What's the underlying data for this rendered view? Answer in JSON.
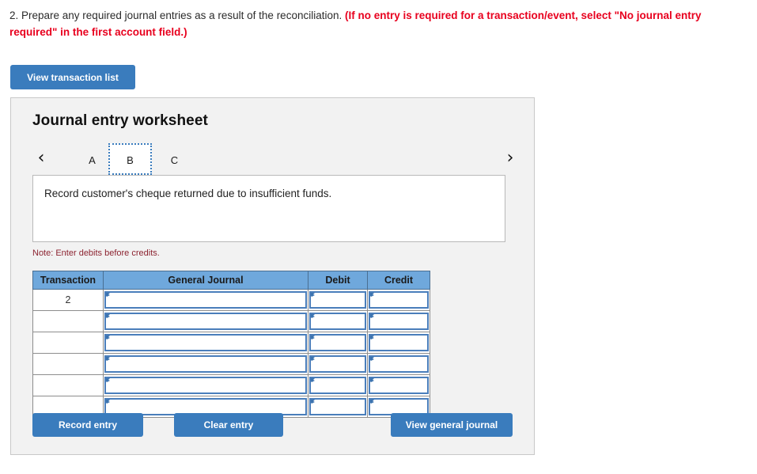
{
  "instruction": {
    "plain": "2. Prepare any required journal entries as a result of the reconciliation. ",
    "emphasis": "(If no entry is required for a transaction/event, select \"No journal entry required\" in the first account field.)"
  },
  "toolbar": {
    "view_transaction_list_label": "View transaction list"
  },
  "worksheet": {
    "title": "Journal entry worksheet",
    "tabs": [
      {
        "label": "A",
        "active": false
      },
      {
        "label": "B",
        "active": true
      },
      {
        "label": "C",
        "active": false
      }
    ],
    "nav": {
      "prev_icon": "chevron-left-icon",
      "next_icon": "chevron-right-icon",
      "prev_glyph": "‹",
      "next_glyph": "›"
    },
    "description": "Record customer's cheque returned due to insufficient funds.",
    "note": "Note: Enter debits before credits.",
    "table": {
      "headers": [
        "Transaction",
        "General Journal",
        "Debit",
        "Credit"
      ],
      "rows": [
        {
          "transaction": "2",
          "general_journal": "",
          "debit": "",
          "credit": ""
        },
        {
          "transaction": "",
          "general_journal": "",
          "debit": "",
          "credit": ""
        },
        {
          "transaction": "",
          "general_journal": "",
          "debit": "",
          "credit": ""
        },
        {
          "transaction": "",
          "general_journal": "",
          "debit": "",
          "credit": ""
        },
        {
          "transaction": "",
          "general_journal": "",
          "debit": "",
          "credit": ""
        },
        {
          "transaction": "",
          "general_journal": "",
          "debit": "",
          "credit": ""
        }
      ]
    },
    "footer": {
      "record_entry_label": "Record entry",
      "clear_entry_label": "Clear entry",
      "view_general_journal_label": "View general journal"
    }
  },
  "colors": {
    "button_blue": "#3a7cbd",
    "header_blue": "#6fa8dc",
    "emphasis_red": "#e8001e",
    "note_red": "#8c2330",
    "panel_bg": "#f2f2f2",
    "input_border_blue": "#4a7ebb"
  }
}
